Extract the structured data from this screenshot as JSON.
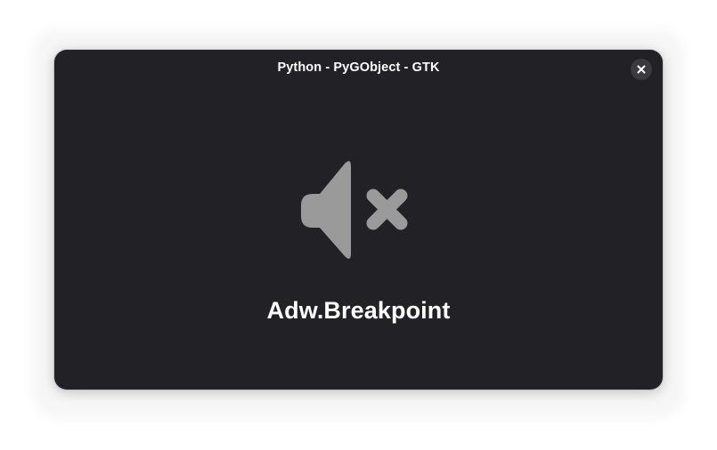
{
  "window": {
    "title": "Python - PyGObject - GTK",
    "close_icon": "close-icon",
    "background_color": "#222226"
  },
  "status_page": {
    "icon": "audio-volume-muted-icon",
    "icon_color": "#9a9a9a",
    "title": "Adw.Breakpoint"
  }
}
